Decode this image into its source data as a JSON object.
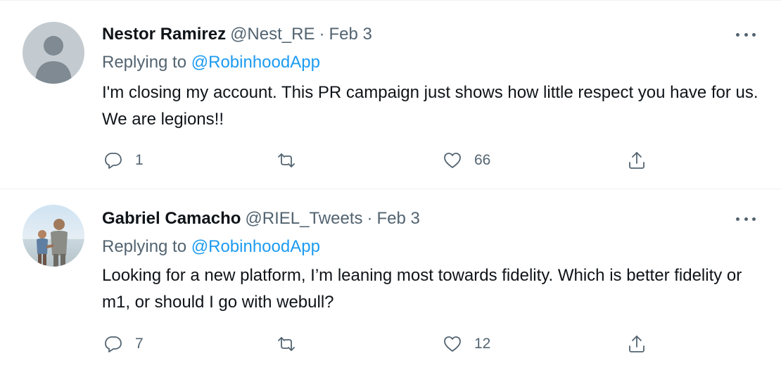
{
  "tweets": [
    {
      "name": "Nestor Ramirez",
      "handle": "@Nest_RE",
      "separator": "·",
      "date": "Feb 3",
      "replying_prefix": "Replying to",
      "replying_to": "@RobinhoodApp",
      "text": "I'm closing my account. This PR campaign just shows how little respect you have for us. We are legions!!",
      "reply_count": "1",
      "retweet_count": "",
      "like_count": "66",
      "avatar_icon": "default-profile-icon"
    },
    {
      "name": "Gabriel Camacho",
      "handle": "@RIEL_Tweets",
      "separator": "·",
      "date": "Feb 3",
      "replying_prefix": "Replying to",
      "replying_to": "@RobinhoodApp",
      "text": "Looking for a new platform, I’m leaning most towards fidelity. Which is better fidelity or m1, or should I go with webull?",
      "reply_count": "7",
      "retweet_count": "",
      "like_count": "12",
      "avatar_icon": "profile-photo"
    }
  ],
  "icons": {
    "reply": "reply-icon",
    "retweet": "retweet-icon",
    "like": "heart-icon",
    "share": "share-icon",
    "more": "more-options-icon"
  },
  "colors": {
    "text": "#0f1419",
    "secondary": "#536471",
    "link": "#1d9bf0",
    "divider": "#eff3f4"
  }
}
